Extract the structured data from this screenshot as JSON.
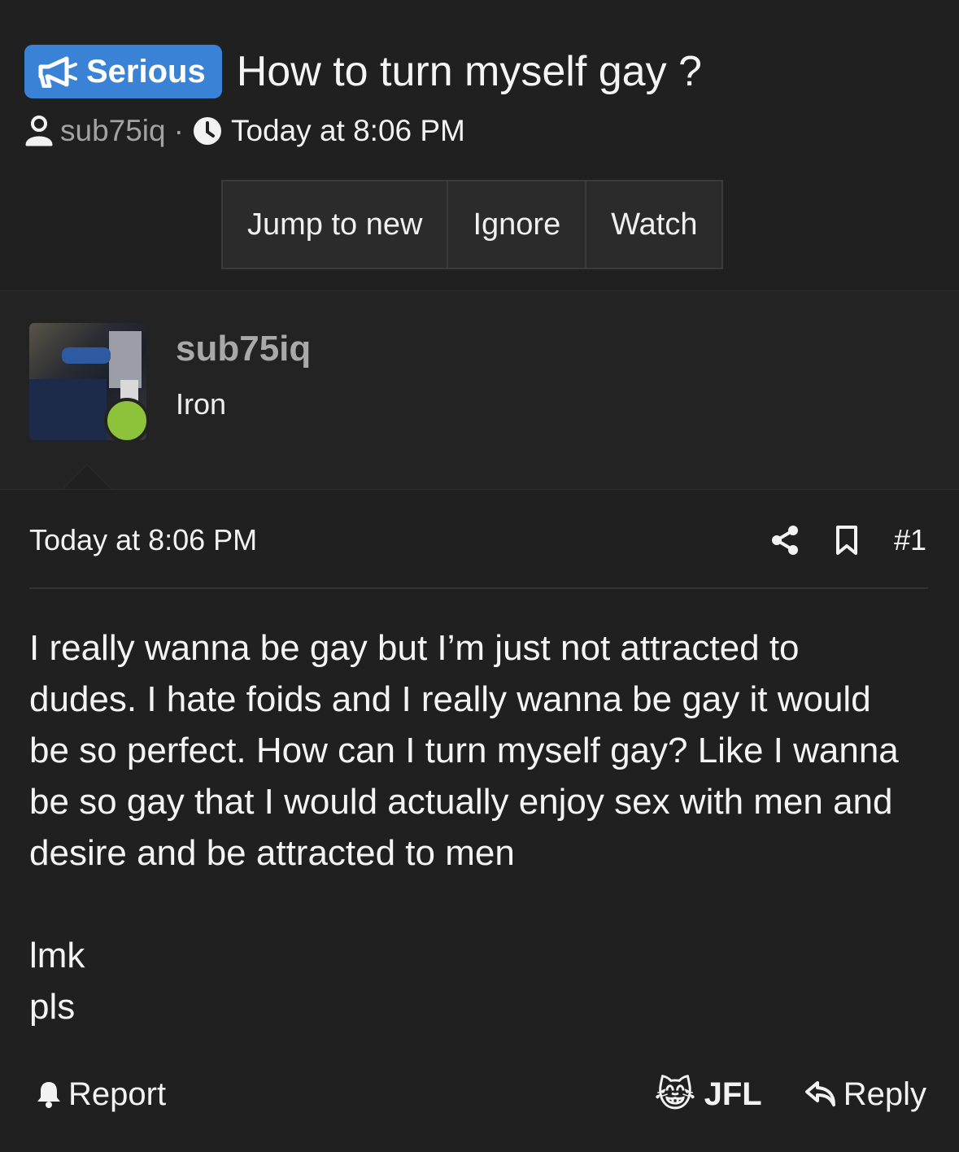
{
  "thread": {
    "prefix_label": "Serious",
    "title": "How to turn myself gay ?",
    "author": "sub75iq",
    "separator": "·",
    "time": "Today at 8:06 PM"
  },
  "toolbar": {
    "jump_label": "Jump to new",
    "ignore_label": "Ignore",
    "watch_label": "Watch"
  },
  "post": {
    "username": "sub75iq",
    "rank": "Iron",
    "date": "Today at 8:06 PM",
    "number": "#1",
    "lines": [
      "I really wanna be gay but I’m just not attracted to",
      "dudes. I hate foids and I really wanna be gay it would",
      "be so perfect. How can I turn myself gay? Like I wanna",
      "be so gay that I would actually enjoy sex with men and",
      "desire and be attracted to men"
    ],
    "extra_lines": [
      "lmk",
      "pls"
    ]
  },
  "footer": {
    "report_label": "Report",
    "jfl_emoji": "😹",
    "jfl_label": "JFL",
    "reply_label": "Reply"
  },
  "icons": {
    "megaphone": "megaphone-icon",
    "user": "user-icon",
    "clock": "clock-icon",
    "share": "share-icon",
    "bookmark": "bookmark-icon",
    "bell": "bell-icon",
    "reply": "reply-icon"
  },
  "colors": {
    "background": "#202020",
    "badge": "#3a82d6",
    "online": "#8dc33a"
  }
}
